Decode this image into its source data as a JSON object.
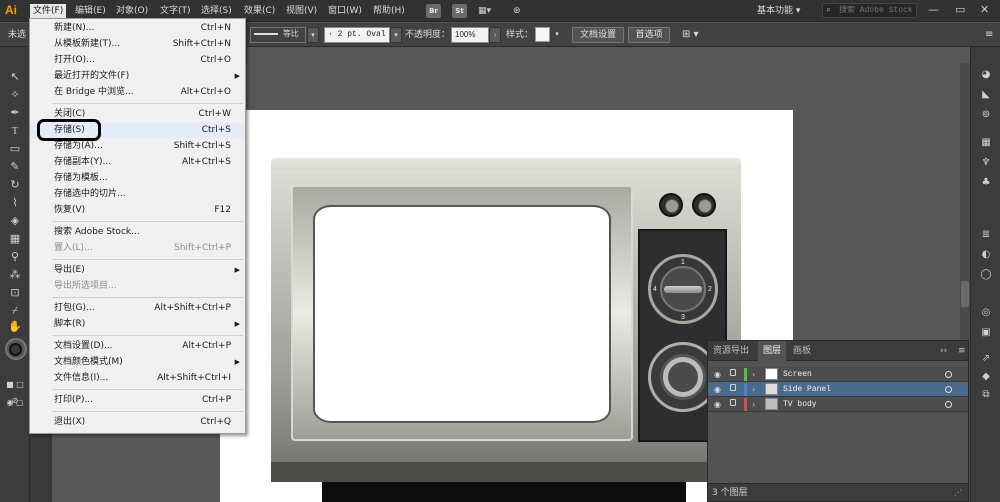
{
  "menubar": {
    "logo": "Ai",
    "items": [
      "文件(F)",
      "编辑(E)",
      "对象(O)",
      "文字(T)",
      "选择(S)",
      "效果(C)",
      "视图(V)",
      "窗口(W)",
      "帮助(H)"
    ],
    "bridge_btn": "Br",
    "stock_btn": "St",
    "workspace": "基本功能",
    "stock_search_placeholder": "搜索 Adobe Stock"
  },
  "controlbar": {
    "left_label": "未选",
    "stroke_profile": "等比",
    "brush_value": "· 2 pt. Oval",
    "opacity_label": "不透明度：",
    "opacity_value": "100%",
    "style_label": "样式：",
    "doc_setup": "文档设置",
    "preferences": "首选项"
  },
  "file_menu": {
    "items": [
      {
        "label": "新建(N)...",
        "shortcut": "Ctrl+N"
      },
      {
        "label": "从模板新建(T)...",
        "shortcut": "Shift+Ctrl+N"
      },
      {
        "label": "打开(O)...",
        "shortcut": "Ctrl+O"
      },
      {
        "label": "最近打开的文件(F)",
        "shortcut": ""
      },
      {
        "label": "在 Bridge 中浏览...",
        "shortcut": "Alt+Ctrl+O"
      },
      {
        "label": "关闭(C)",
        "shortcut": "Ctrl+W"
      },
      {
        "label": "存储(S)",
        "shortcut": "Ctrl+S"
      },
      {
        "label": "存储为(A)...",
        "shortcut": "Shift+Ctrl+S"
      },
      {
        "label": "存储副本(Y)...",
        "shortcut": "Alt+Ctrl+S"
      },
      {
        "label": "存储为模板...",
        "shortcut": ""
      },
      {
        "label": "存储选中的切片...",
        "shortcut": ""
      },
      {
        "label": "恢复(V)",
        "shortcut": "F12"
      },
      {
        "label": "搜索 Adobe Stock...",
        "shortcut": ""
      },
      {
        "label": "置入(L)...",
        "shortcut": "Shift+Ctrl+P"
      },
      {
        "label": "导出(E)",
        "shortcut": ""
      },
      {
        "label": "导出所选项目...",
        "shortcut": ""
      },
      {
        "label": "打包(G)...",
        "shortcut": "Alt+Shift+Ctrl+P"
      },
      {
        "label": "脚本(R)",
        "shortcut": ""
      },
      {
        "label": "文档设置(D)...",
        "shortcut": "Alt+Ctrl+P"
      },
      {
        "label": "文档颜色模式(M)",
        "shortcut": ""
      },
      {
        "label": "文件信息(I)...",
        "shortcut": "Alt+Shift+Ctrl+I"
      },
      {
        "label": "打印(P)...",
        "shortcut": "Ctrl+P"
      },
      {
        "label": "退出(X)",
        "shortcut": "Ctrl+Q"
      }
    ]
  },
  "tv": {
    "dial_numbers": [
      "1",
      "2",
      "3",
      "4"
    ]
  },
  "layers_panel": {
    "tabs": [
      "资源导出",
      "图层",
      "画板"
    ],
    "layers": [
      {
        "name": "Screen",
        "color": "#4fc24f"
      },
      {
        "name": "Side Panel",
        "color": "#4f7fd6"
      },
      {
        "name": "TV body",
        "color": "#d64f4f"
      }
    ],
    "count": "3 个图层"
  }
}
